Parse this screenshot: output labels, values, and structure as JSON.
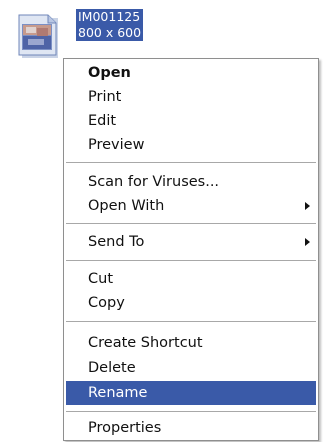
{
  "file": {
    "icon": "image-file-icon",
    "name": "IM001125",
    "dimensions": "800 x 600"
  },
  "menu": {
    "open": "Open",
    "print": "Print",
    "edit": "Edit",
    "preview": "Preview",
    "scan": "Scan for Viruses...",
    "open_with": "Open With",
    "send_to": "Send To",
    "cut": "Cut",
    "copy": "Copy",
    "create_shortcut": "Create Shortcut",
    "delete": "Delete",
    "rename": "Rename",
    "properties": "Properties"
  },
  "colors": {
    "selection": "#3a5aa8"
  }
}
